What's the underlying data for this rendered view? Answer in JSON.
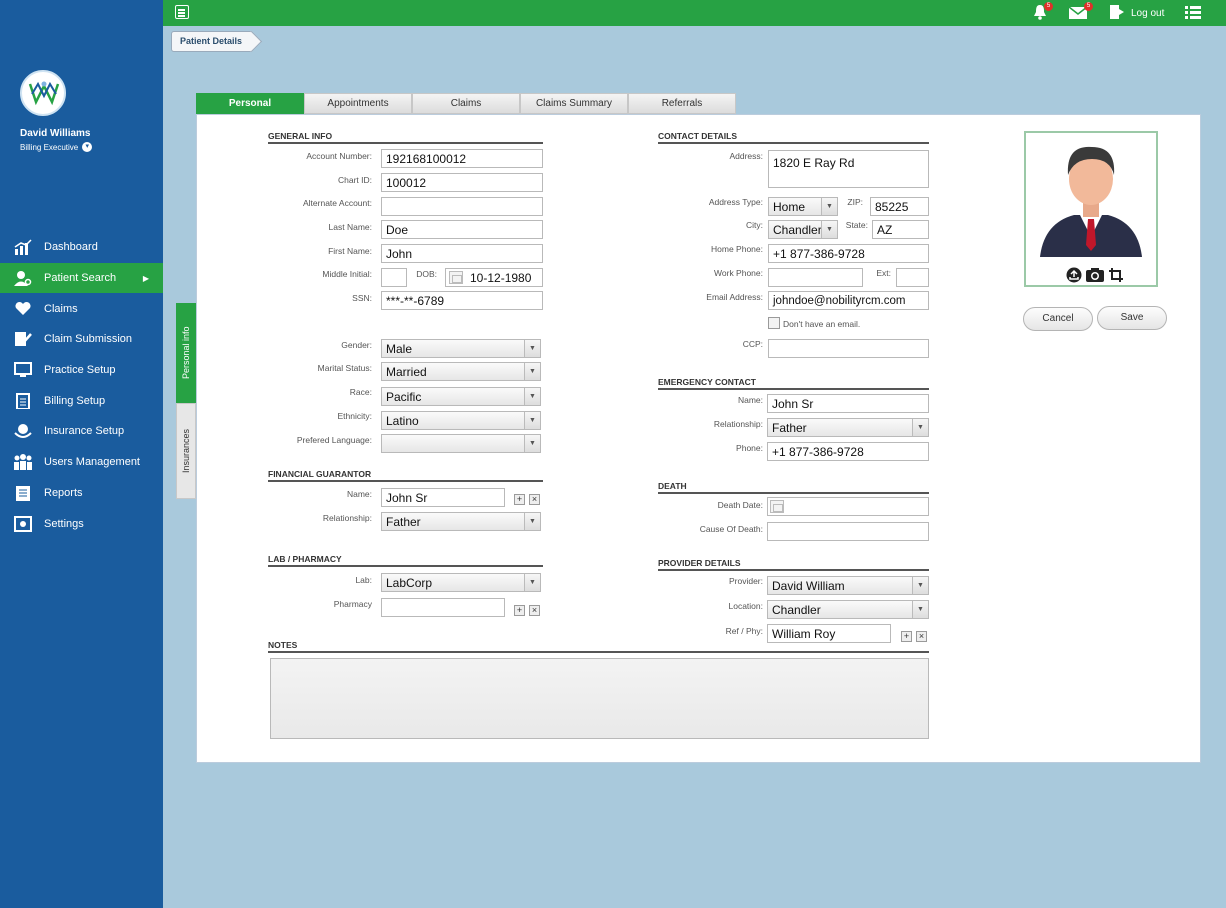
{
  "user": {
    "name": "David Williams",
    "role": "Billing Executive"
  },
  "sidebar": {
    "items": [
      {
        "label": "Dashboard",
        "icon": "bar-chart-icon"
      },
      {
        "label": "Patient Search",
        "icon": "user-search-icon",
        "active": true
      },
      {
        "label": "Claims",
        "icon": "heart-hands-icon"
      },
      {
        "label": "Claim Submission",
        "icon": "edit-document-icon"
      },
      {
        "label": "Practice Setup",
        "icon": "monitor-icon"
      },
      {
        "label": "Billing Setup",
        "icon": "clipboard-icon"
      },
      {
        "label": "Insurance Setup",
        "icon": "insurance-icon"
      },
      {
        "label": "Users Management",
        "icon": "users-icon"
      },
      {
        "label": "Reports",
        "icon": "report-icon"
      },
      {
        "label": "Settings",
        "icon": "settings-icon"
      }
    ]
  },
  "topbar": {
    "notifications": "5",
    "messages": "5",
    "logout": "Log out"
  },
  "breadcrumb": "Patient Details",
  "tabs": [
    "Personal",
    "Appointments",
    "Claims",
    "Claims Summary",
    "Referrals"
  ],
  "side_tabs": [
    "Personal info",
    "Insurances"
  ],
  "general": {
    "title": "GENERAL INFO",
    "account_label": "Account Number:",
    "account": "192168100012",
    "chart_label": "Chart ID:",
    "chart": "100012",
    "alt_label": "Alternate Account:",
    "alt": "",
    "last_label": "Last Name:",
    "last": "Doe",
    "first_label": "First Name:",
    "first": "John",
    "middle_label": "Middle Initial:",
    "middle": "",
    "dob_label": "DOB:",
    "dob": "10-12-1980",
    "ssn_label": "SSN:",
    "ssn": "***-**-6789",
    "gender_label": "Gender:",
    "gender": "Male",
    "marital_label": "Marital Status:",
    "marital": "Married",
    "race_label": "Race:",
    "race": "Pacific",
    "ethnicity_label": "Ethnicity:",
    "ethnicity": "Latino",
    "language_label": "Prefered Language:",
    "language": ""
  },
  "guarantor": {
    "title": "FINANCIAL GUARANTOR",
    "name_label": "Name:",
    "name": "John Sr",
    "rel_label": "Relationship:",
    "rel": "Father"
  },
  "lab": {
    "title": "LAB / PHARMACY",
    "lab_label": "Lab:",
    "lab": "LabCorp",
    "pharmacy_label": "Pharmacy",
    "pharmacy": ""
  },
  "contact": {
    "title": "CONTACT DETAILS",
    "address_label": "Address:",
    "address": "1820 E Ray Rd",
    "type_label": "Address Type:",
    "type": "Home",
    "zip_label": "ZIP:",
    "zip": "85225",
    "city_label": "City:",
    "city": "Chandler",
    "state_label": "State:",
    "state": "AZ",
    "home_label": "Home Phone:",
    "home": "+1 877-386-9728",
    "work_label": "Work Phone:",
    "work": "",
    "ext_label": "Ext:",
    "ext": "",
    "email_label": "Email Address:",
    "email": "johndoe@nobilityrcm.com",
    "no_email": "Don't have an email.",
    "ccp_label": "CCP:",
    "ccp": ""
  },
  "emergency": {
    "title": "EMERGENCY CONTACT",
    "name_label": "Name:",
    "name": "John Sr",
    "rel_label": "Relationship:",
    "rel": "Father",
    "phone_label": "Phone:",
    "phone": "+1 877-386-9728"
  },
  "death": {
    "title": "DEATH",
    "date_label": "Death Date:",
    "date": "",
    "cause_label": "Cause Of Death:",
    "cause": ""
  },
  "provider": {
    "title": "PROVIDER DETAILS",
    "provider_label": "Provider:",
    "provider": "David William",
    "location_label": "Location:",
    "location": "Chandler",
    "ref_label": "Ref / Phy:",
    "ref": "William Roy"
  },
  "notes": {
    "title": "NOTES",
    "value": ""
  },
  "actions": {
    "cancel": "Cancel",
    "save": "Save"
  },
  "colors": {
    "sidebar": "#1a5c9e",
    "accent": "#27a244",
    "background": "#a9c9dc"
  }
}
